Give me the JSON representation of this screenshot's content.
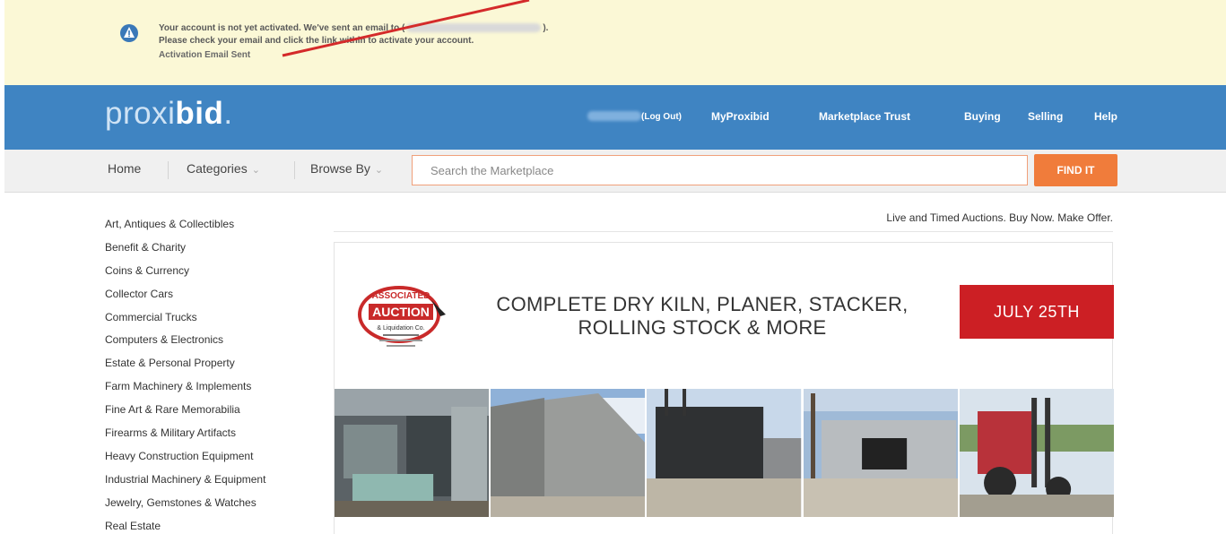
{
  "notice": {
    "line1_prefix": "Your account is not yet activated. We've sent an email to (",
    "line1_suffix": ").",
    "line2": "Please check your email and click the link within to activate your account.",
    "line3": "Activation Email Sent"
  },
  "header": {
    "logo_light": "proxi",
    "logo_bold": "bid",
    "logo_dot": ".",
    "logout": "(Log Out)",
    "nav": {
      "myproxibid": "MyProxibid",
      "trust": "Marketplace Trust",
      "buying": "Buying",
      "selling": "Selling",
      "help": "Help"
    }
  },
  "subnav": {
    "home": "Home",
    "categories": "Categories",
    "browse_by": "Browse By",
    "search_placeholder": "Search the Marketplace",
    "find_button": "FIND IT"
  },
  "categories": [
    "Art, Antiques & Collectibles",
    "Benefit & Charity",
    "Coins & Currency",
    "Collector Cars",
    "Commercial Trucks",
    "Computers & Electronics",
    "Estate & Personal Property",
    "Farm Machinery & Implements",
    "Fine Art & Rare Memorabilia",
    "Firearms & Military Artifacts",
    "Heavy Construction Equipment",
    "Industrial Machinery & Equipment",
    "Jewelry, Gemstones & Watches",
    "Real Estate"
  ],
  "main": {
    "tagline": "Live and Timed Auctions. Buy Now. Make Offer.",
    "promo": {
      "logo_text_top": "ASSOCIATED",
      "logo_text_main": "AUCTION",
      "logo_text_sub": "& Liquidation Co.",
      "headline_line1": "COMPLETE DRY KILN, PLANER, STACKER,",
      "headline_line2": "ROLLING STOCK & MORE",
      "date": "JULY 25TH"
    }
  },
  "colors": {
    "banner_bg": "#fbf8d6",
    "header_blue": "#3f84c2",
    "find_orange": "#f07c3b",
    "date_red": "#cc1f24"
  }
}
